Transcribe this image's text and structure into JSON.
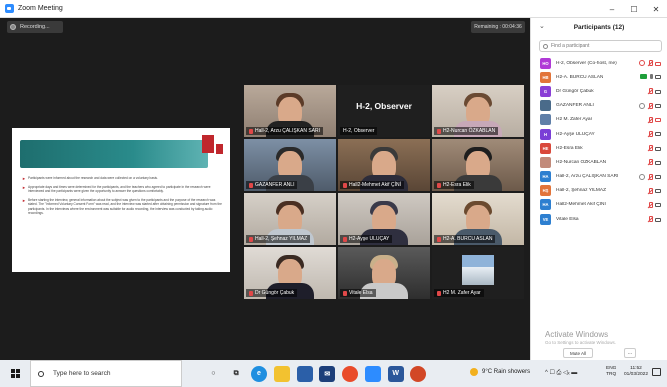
{
  "window": {
    "title": "Zoom Meeting",
    "minimize": "–",
    "maximize": "☐",
    "close": "✕"
  },
  "meeting": {
    "recording_label": "Recording...",
    "remaining_label": "Remaining : 00:04:36"
  },
  "slide": {
    "bullets": [
      "Participants were informed about the research and data were collected on a voluntary basis.",
      "Appropriate days and times were determined for the participants, and the teachers who agreed to participate in the research were interviewed and the participants were given the opportunity to answer the questions comfortably.",
      "Before starting the interview, general information about the subject was given to the participants and the purpose of the research was stated. The \"Informed Voluntary Consent Form\" was read, and the interview was started after obtaining permission and signature from the participants. In the interviews where the environment was suitable for audio recording, the interview was conducted by taking audio recordings."
    ]
  },
  "tiles": [
    {
      "name": "Hall-2, Arzu ÇALIŞKAN SARI"
    },
    {
      "name": "H-2, Observer",
      "big": "H-2, Observer"
    },
    {
      "name": "H2-Nurcan ÖZKABLAN"
    },
    {
      "name": "GAZANFER ANLI"
    },
    {
      "name": "Hall2-Mehmet Akif ÇİNİ"
    },
    {
      "name": "H2-Esra Elik"
    },
    {
      "name": "Hall-2, Şehnaz YILMAZ"
    },
    {
      "name": "H2-Ayşe ULUÇAY"
    },
    {
      "name": "H2-A. BURCU ASLAN"
    },
    {
      "name": "Dr Güngör Çabuk"
    },
    {
      "name": "Vitale Elsa"
    },
    {
      "name": "H2 M. Zafer Ayar"
    }
  ],
  "participants": {
    "title": "Participants (12)",
    "search_placeholder": "Find a participant",
    "list": [
      {
        "initials": "HO",
        "name": "H-2, Observer (Co-host, me)",
        "color": "#b03ad6"
      },
      {
        "initials": "HB",
        "name": "H2-A. BURCU ASLAN",
        "color": "#e2743a"
      },
      {
        "initials": "G",
        "name": "Dr Güngör Çabuk",
        "color": "#8a3fd6"
      },
      {
        "initials": "",
        "name": "GAZANFER ANLI",
        "color": "#4a6b8a"
      },
      {
        "initials": "",
        "name": "H2 M. Zafer Ayar",
        "color": "#5f7fa8"
      },
      {
        "initials": "H",
        "name": "H2-Ayşe ULUÇAY",
        "color": "#7a3fd6"
      },
      {
        "initials": "HE",
        "name": "H2-Esra Elik",
        "color": "#d9483b"
      },
      {
        "initials": "",
        "name": "H2-Nurcan ÖZKABLAN",
        "color": "#c28a7a"
      },
      {
        "initials": "HA",
        "name": "Hall-2, Arzu ÇALIŞKAN SARI",
        "color": "#2d7fd0"
      },
      {
        "initials": "HŞ",
        "name": "Hall-2, Şehnaz YILMAZ",
        "color": "#e2743a"
      },
      {
        "initials": "HA",
        "name": "Hall2-Mehmet Akif ÇİNİ",
        "color": "#2d7fd0"
      },
      {
        "initials": "VE",
        "name": "Vitale Elsa",
        "color": "#2d7fd0"
      }
    ],
    "mute_all_label": "Mute All",
    "more_label": "..."
  },
  "activation": {
    "title": "Activate Windows",
    "subtitle": "Go to Settings to activate Windows."
  },
  "taskbar": {
    "search_placeholder": "Type here to search",
    "weather": "9°C  Rain showers",
    "tray": "^ ☐ ⎙ ◁ₓ ▬",
    "lang_top": "ENG",
    "lang_bottom": "TRQ",
    "time": "11:52",
    "date": "01/03/2022"
  }
}
